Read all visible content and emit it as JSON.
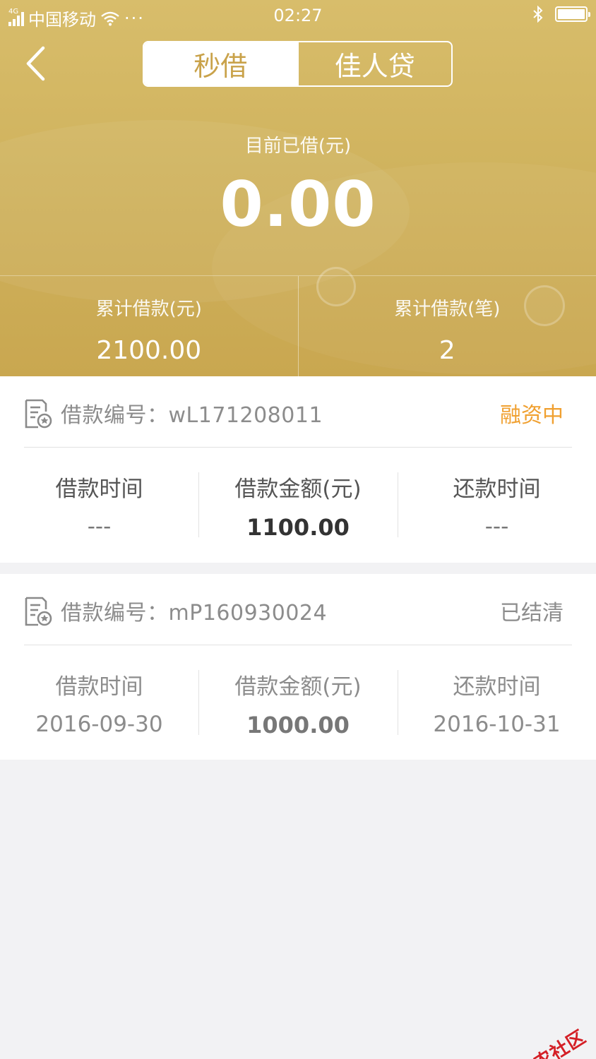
{
  "status_bar": {
    "network": "4G",
    "carrier": "中国移动",
    "more": "···",
    "time": "02:27"
  },
  "nav": {
    "tabs": [
      {
        "label": "秒借",
        "active": true
      },
      {
        "label": "佳人贷",
        "active": false
      }
    ]
  },
  "summary": {
    "current_label": "目前已借(元)",
    "current_amount": "0.00",
    "total_amount_label": "累计借款(元)",
    "total_amount": "2100.00",
    "total_count_label": "累计借款(笔)",
    "total_count": "2"
  },
  "loans": [
    {
      "number_label": "借款编号：",
      "number": "wL171208011",
      "status": "融资中",
      "loan_time_label": "借款时间",
      "loan_time": "---",
      "amount_label": "借款金额(元)",
      "amount": "1100.00",
      "repay_time_label": "还款时间",
      "repay_time": "---"
    },
    {
      "number_label": "借款编号：",
      "number": "mP160930024",
      "status": "已结清",
      "loan_time_label": "借款时间",
      "loan_time": "2016-09-30",
      "amount_label": "借款金额(元)",
      "amount": "1000.00",
      "repay_time_label": "还款时间",
      "repay_time": "2016-10-31"
    }
  ],
  "watermark": "卡农社区",
  "colors": {
    "header_gold": "#d0b35e",
    "active_tab_text": "#c9a24a",
    "status_active": "#f0a030",
    "watermark_red": "#d41f26"
  }
}
